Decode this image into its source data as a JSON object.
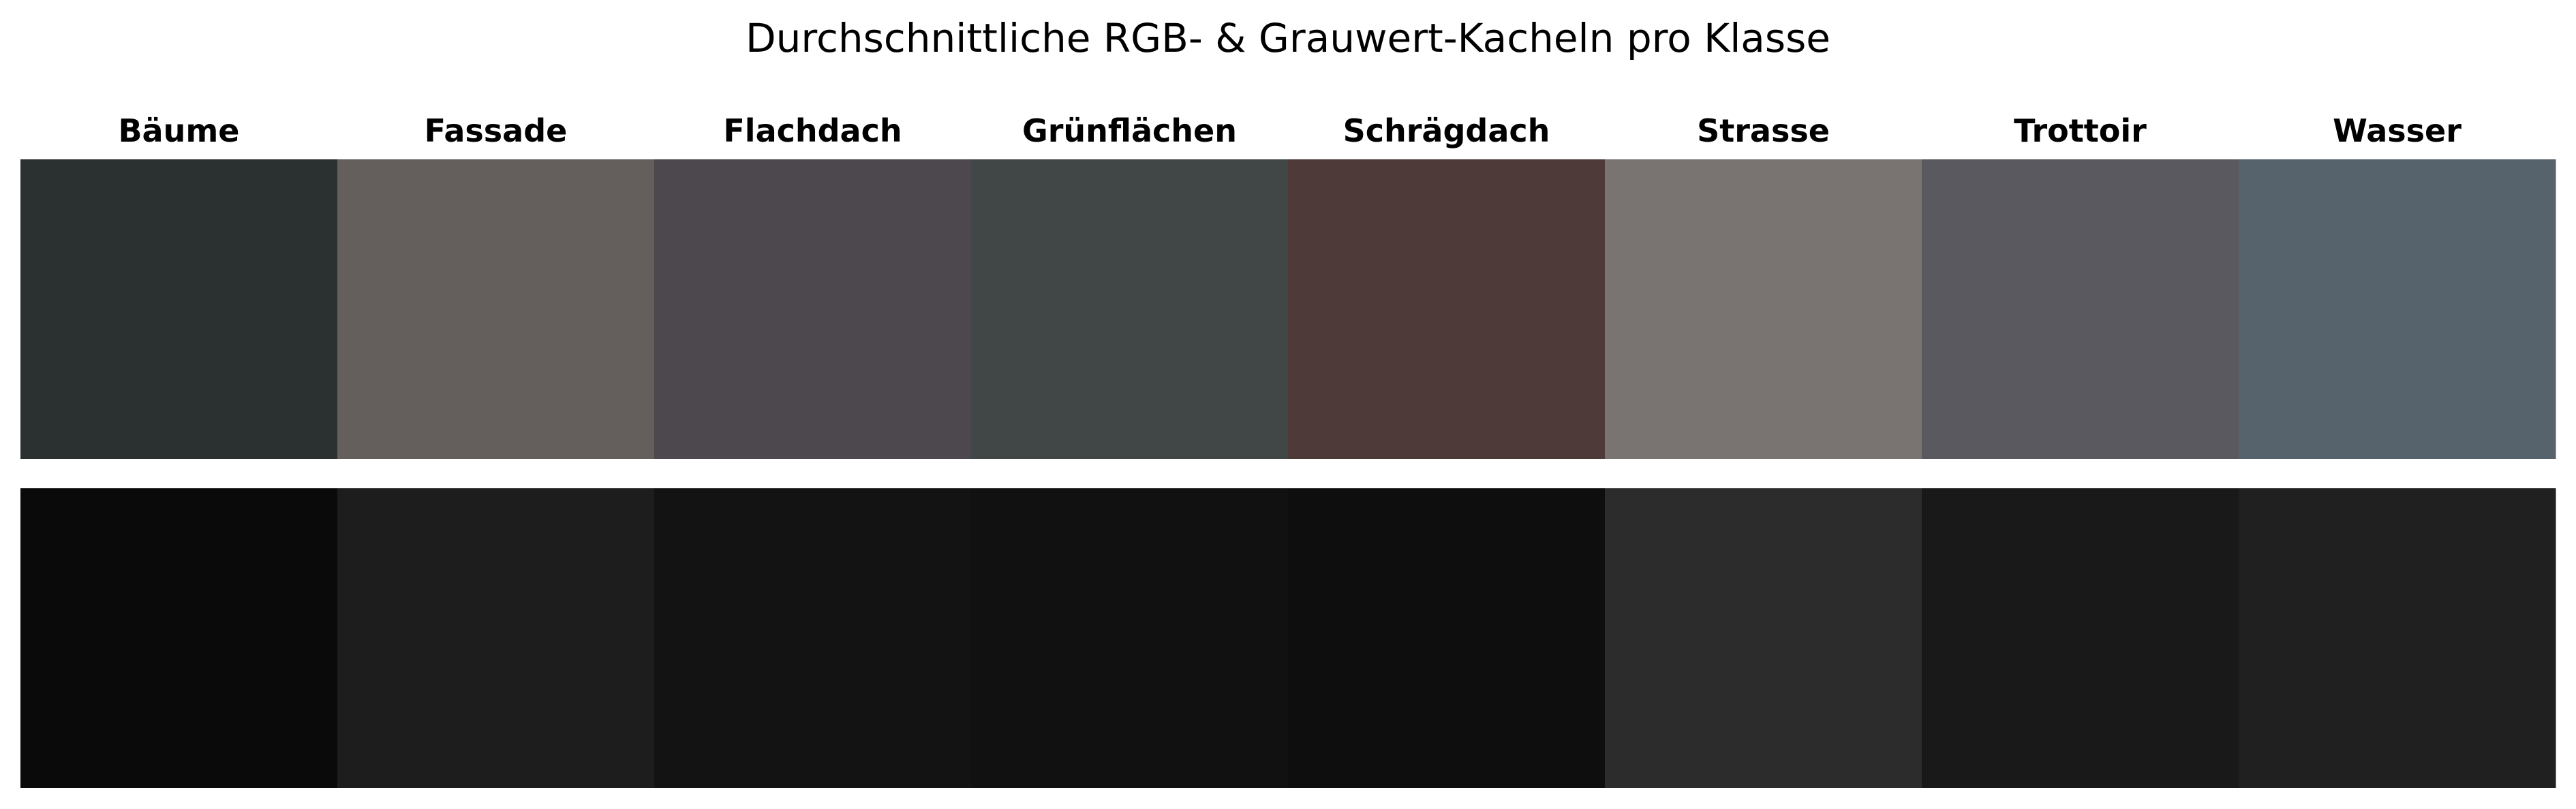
{
  "chart_data": {
    "type": "heatmap",
    "title": "Durchschnittliche RGB- & Grauwert-Kacheln pro Klasse",
    "categories": [
      "Bäume",
      "Fassade",
      "Flachdach",
      "Grünflächen",
      "Schrägdach",
      "Strasse",
      "Trottoir",
      "Wasser"
    ],
    "rows": [
      {
        "name": "RGB",
        "colors": [
          "#2b3130",
          "#645e5d",
          "#4d484d",
          "#414746",
          "#4f3a3a",
          "#797372",
          "#5a595f",
          "#56626c"
        ]
      },
      {
        "name": "Grauwert",
        "colors": [
          "#0a0a0a",
          "#1d1d1d",
          "#131313",
          "#111111",
          "#0e0e0e",
          "#2c2c2c",
          "#191919",
          "#202020"
        ]
      }
    ],
    "grid": false,
    "legend": "none",
    "axes": "off"
  }
}
